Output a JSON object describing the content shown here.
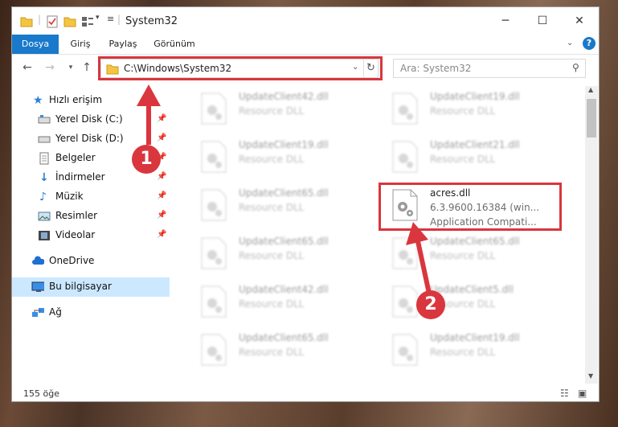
{
  "window": {
    "title": "System32",
    "controls": [
      "minimize-icon",
      "maximize-icon",
      "close-icon"
    ]
  },
  "ribbon": {
    "tabs": [
      {
        "label": "Dosya",
        "active": true
      },
      {
        "label": "Giriş",
        "active": false
      },
      {
        "label": "Paylaş",
        "active": false
      },
      {
        "label": "Görünüm",
        "active": false
      }
    ]
  },
  "address": {
    "path": "C:\\Windows\\System32",
    "search_placeholder": "Ara: System32"
  },
  "nav": {
    "items": [
      {
        "label": "Hızlı erişim",
        "icon": "star-icon",
        "pinned": false
      },
      {
        "label": "Yerel Disk (C:)",
        "icon": "drive-icon",
        "pinned": true
      },
      {
        "label": "Yerel Disk (D:)",
        "icon": "drive-icon",
        "pinned": true
      },
      {
        "label": "Belgeler",
        "icon": "documents-icon",
        "pinned": true
      },
      {
        "label": "İndirmeler",
        "icon": "download-icon",
        "pinned": true
      },
      {
        "label": "Müzik",
        "icon": "music-icon",
        "pinned": true
      },
      {
        "label": "Resimler",
        "icon": "pictures-icon",
        "pinned": true
      },
      {
        "label": "Videolar",
        "icon": "video-icon",
        "pinned": true
      },
      {
        "label": "OneDrive",
        "icon": "cloud-icon",
        "pinned": false
      },
      {
        "label": "Bu bilgisayar",
        "icon": "computer-icon",
        "pinned": false,
        "selected": true
      },
      {
        "label": "Ağ",
        "icon": "network-icon",
        "pinned": false
      }
    ]
  },
  "files": {
    "left": [
      {
        "name": "UpdateClient42.dll",
        "desc": "Resource DLL"
      },
      {
        "name": "UpdateClient19.dll",
        "desc": "Resource DLL"
      },
      {
        "name": "UpdateClient65.dll",
        "desc": "Resource DLL"
      },
      {
        "name": "UpdateClient65.dll",
        "desc": "Resource DLL"
      },
      {
        "name": "UpdateClient42.dll",
        "desc": "Resource DLL"
      },
      {
        "name": "UpdateClient65.dll",
        "desc": "Resource DLL"
      }
    ],
    "right": [
      {
        "name": "UpdateClient19.dll",
        "desc": "Resource DLL"
      },
      {
        "name": "UpdateClient21.dll",
        "desc": "Resource DLL"
      },
      {
        "name": "acres.dll",
        "desc": "6.3.9600.16384 (win...",
        "desc2": "Application Compati...",
        "highlight": true
      },
      {
        "name": "UpdateClient65.dll",
        "desc": "Resource DLL"
      },
      {
        "name": "UpdateClient5.dll",
        "desc": "Resource DLL"
      },
      {
        "name": "UpdateClient19.dll",
        "desc": "Resource DLL"
      }
    ]
  },
  "status": {
    "count": "155 öğe"
  },
  "annotations": {
    "marker1": "1",
    "marker2": "2",
    "color": "#d9363e"
  }
}
